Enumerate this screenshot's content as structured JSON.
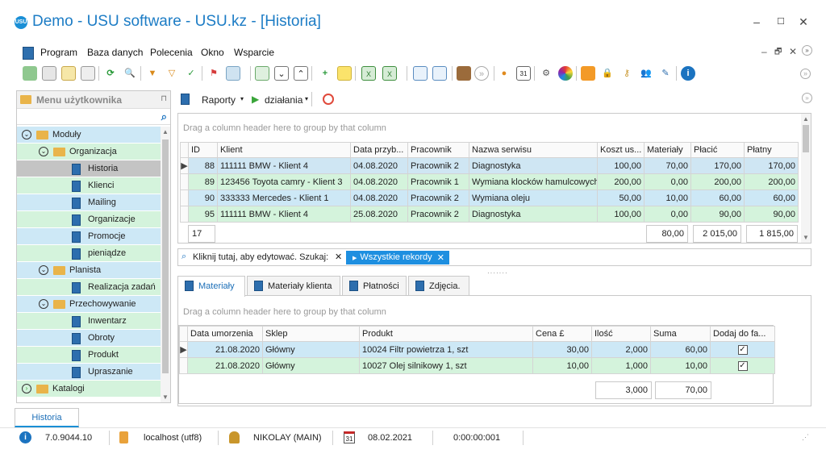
{
  "window": {
    "title": "Demo - USU software - USU.kz - [Historia]",
    "logo_text": "USU",
    "minimize": "–",
    "maximize": "☐",
    "close": "✕"
  },
  "menu": {
    "items": [
      "Program",
      "Baza danych",
      "Polecenia",
      "Okno",
      "Wsparcie"
    ],
    "mdi_controls": [
      "–",
      "🗗",
      "✕"
    ]
  },
  "left_panel": {
    "header": "Menu użytkownika",
    "pin": "⊓",
    "search_icon": "search-icon",
    "tree": [
      {
        "label": "Moduły",
        "level": 0,
        "kind": "folder",
        "expander": "⊘"
      },
      {
        "label": "Organizacja",
        "level": 1,
        "kind": "folder",
        "expander": "⊘"
      },
      {
        "label": "Historia",
        "level": 2,
        "kind": "doc",
        "selected": true
      },
      {
        "label": "Klienci",
        "level": 2,
        "kind": "doc"
      },
      {
        "label": "Mailing",
        "level": 2,
        "kind": "doc"
      },
      {
        "label": "Organizacje",
        "level": 2,
        "kind": "doc"
      },
      {
        "label": "Promocje",
        "level": 2,
        "kind": "doc"
      },
      {
        "label": "pieniądze",
        "level": 2,
        "kind": "doc"
      },
      {
        "label": "Planista",
        "level": 1,
        "kind": "folder",
        "expander": "⊘"
      },
      {
        "label": "Realizacja zadań",
        "level": 2,
        "kind": "doc"
      },
      {
        "label": "Przechowywanie",
        "level": 1,
        "kind": "folder",
        "expander": "⊘"
      },
      {
        "label": "Inwentarz",
        "level": 2,
        "kind": "doc"
      },
      {
        "label": "Obroty",
        "level": 2,
        "kind": "doc"
      },
      {
        "label": "Produkt",
        "level": 2,
        "kind": "doc"
      },
      {
        "label": "Upraszanie",
        "level": 2,
        "kind": "doc"
      },
      {
        "label": "Katalogi",
        "level": 0,
        "kind": "folder",
        "expander": "⊙"
      }
    ]
  },
  "right_toolbar": {
    "reports": "Raporty",
    "actions": "działania"
  },
  "upper_grid": {
    "group_hint": "Drag a column header here to group by that column",
    "columns": [
      "ID",
      "Klient",
      "Data przyb...",
      "Pracownik",
      "Nazwa serwisu",
      "Koszt us...",
      "Materiały",
      "Płacić",
      "Płatny"
    ],
    "rows": [
      [
        "88",
        "111111 BMW - Klient 4",
        "04.08.2020",
        "Pracownik 2",
        "Diagnostyka",
        "100,00",
        "70,00",
        "170,00",
        "170,00"
      ],
      [
        "89",
        "123456 Toyota camry - Klient 3",
        "04.08.2020",
        "Pracownik 1",
        "Wymiana klocków hamulcowych",
        "200,00",
        "0,00",
        "200,00",
        "200,00"
      ],
      [
        "90",
        "333333 Mercedes - Klient 1",
        "04.08.2020",
        "Pracownik 2",
        "Wymiana oleju",
        "50,00",
        "10,00",
        "60,00",
        "60,00"
      ],
      [
        "95",
        "111111 BMW - Klient 4",
        "25.08.2020",
        "Pracownik 2",
        "Diagnostyka",
        "100,00",
        "0,00",
        "90,00",
        "90,00"
      ]
    ],
    "totals": {
      "count": "17",
      "materials": "80,00",
      "to_pay": "2 015,00",
      "paid": "1 815,00"
    }
  },
  "filter_bar": {
    "prompt": "Kliknij tutaj, aby edytować. Szukaj:",
    "chip": "Wszystkie rekordy"
  },
  "tabs": [
    "Materiały",
    "Materiały klienta",
    "Płatności",
    "Zdjęcia."
  ],
  "lower_grid": {
    "group_hint": "Drag a column header here to group by that column",
    "columns": [
      "Data umorzenia",
      "Sklep",
      "Produkt",
      "Cena £",
      "Ilość",
      "Suma",
      "Dodaj do fa..."
    ],
    "rows": [
      [
        "21.08.2020",
        "Główny",
        "10024 Filtr powietrza 1, szt",
        "30,00",
        "2,000",
        "60,00",
        "✓"
      ],
      [
        "21.08.2020",
        "Główny",
        "10027 Olej silnikowy 1, szt",
        "10,00",
        "1,000",
        "10,00",
        "✓"
      ]
    ],
    "totals": {
      "quantity": "3,000",
      "sum": "70,00"
    }
  },
  "document_tab": "Historia",
  "status": {
    "version": "7.0.9044.10",
    "server": "localhost (utf8)",
    "user": "NIKOLAY (MAIN)",
    "date": "08.02.2021",
    "timer": "0:00:00:001"
  },
  "colors": {
    "accent": "#1a8fd6",
    "title": "#1c7cc5",
    "row_blue": "#cde8f6",
    "row_green": "#d4f3dc",
    "chip": "#1e8fe0"
  }
}
